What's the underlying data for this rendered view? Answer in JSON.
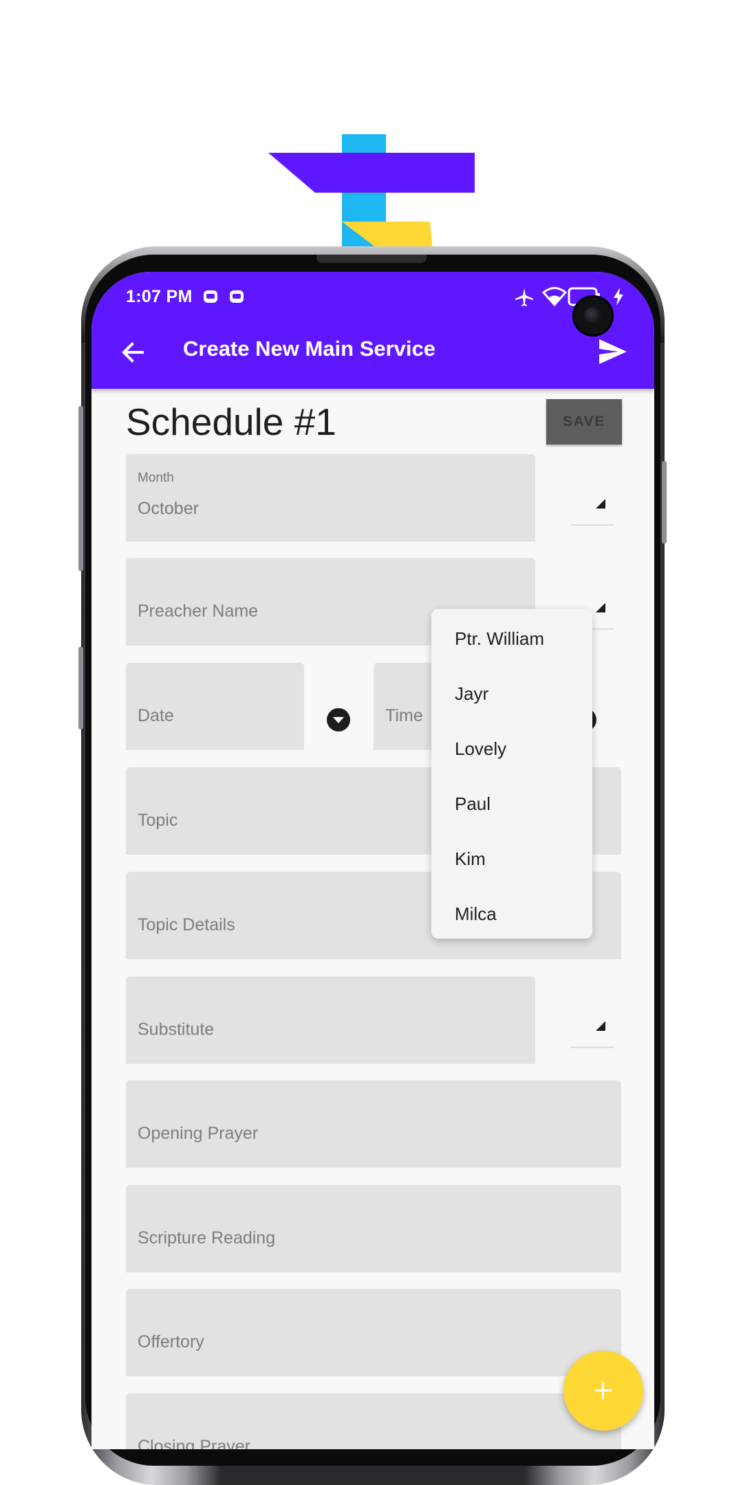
{
  "status_bar": {
    "time": "1:07 PM"
  },
  "app_bar": {
    "title": "Create New Main Service",
    "back_icon": "arrow-back-icon",
    "send_icon": "send-icon"
  },
  "page": {
    "title": "Schedule #1",
    "save_label": "SAVE"
  },
  "fields": {
    "month": {
      "label": "Month",
      "value": "October"
    },
    "preacher_name": {
      "label": "Preacher Name"
    },
    "date": {
      "label": "Date"
    },
    "time": {
      "label": "Time"
    },
    "topic": {
      "label": "Topic"
    },
    "topic_details": {
      "label": "Topic Details"
    },
    "substitute": {
      "label": "Substitute"
    },
    "opening_prayer": {
      "label": "Opening Prayer"
    },
    "scripture_reading": {
      "label": "Scripture Reading"
    },
    "offertory": {
      "label": "Offertory"
    },
    "closing_prayer": {
      "label": "Closing Prayer"
    }
  },
  "preacher_menu": {
    "items": [
      "Ptr. William",
      "Jayr",
      "Lovely",
      "Paul",
      "Kim",
      "Milca"
    ]
  },
  "fab": {
    "icon": "plus-icon"
  },
  "colors": {
    "app_bar": "#5f17ff",
    "field_fill": "#e2e2e2",
    "fab": "#fdd834",
    "save_button": "#5e5e5e"
  }
}
